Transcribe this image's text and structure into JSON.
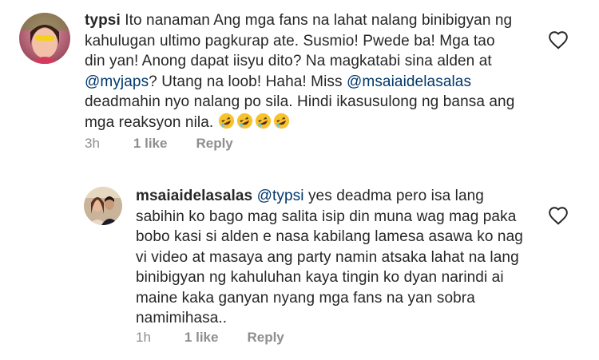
{
  "comments": [
    {
      "username": "typsi",
      "text_1": " Ito nanaman Ang mga fans na lahat nalang binibigyan ng kahulugan ultimo pagkurap ate. Susmio! Pwede ba! Mga tao din yan! Anong dapat iisyu dito? Na magkatabi sina alden at ",
      "mention_1": "@myjaps",
      "text_2": "? Utang na loob! Haha! Miss ",
      "mention_2": "@msaiaidelasalas",
      "text_3": " deadmahin nyo nalang po sila. Hindi ikasusulong ng bansa ang mga reaksyon nila. ",
      "emojis": [
        "rolling-on-floor-laughing-emoji",
        "rolling-on-floor-laughing-emoji",
        "rolling-on-floor-laughing-emoji",
        "rolling-on-floor-laughing-emoji"
      ],
      "time": "3h",
      "likes": "1 like",
      "reply": "Reply"
    },
    {
      "username": "msaiaidelasalas",
      "mention_1": "@typsi",
      "text_1": " yes deadma pero isa lang sabihin ko bago mag salita isip din muna wag mag paka bobo kasi si alden e nasa kabilang lamesa asawa ko nag vi video at masaya ang party namin atsaka lahat na lang binibigyan ng kahuluhan kaya tingin ko dyan narindi ai maine kaka ganyan nyang mga fans na yan sobra namimihasa..",
      "time": "1h",
      "likes": "1 like",
      "reply": "Reply"
    }
  ],
  "colors": {
    "text": "#262626",
    "mention": "#00376b",
    "meta": "#8e8e8e"
  }
}
